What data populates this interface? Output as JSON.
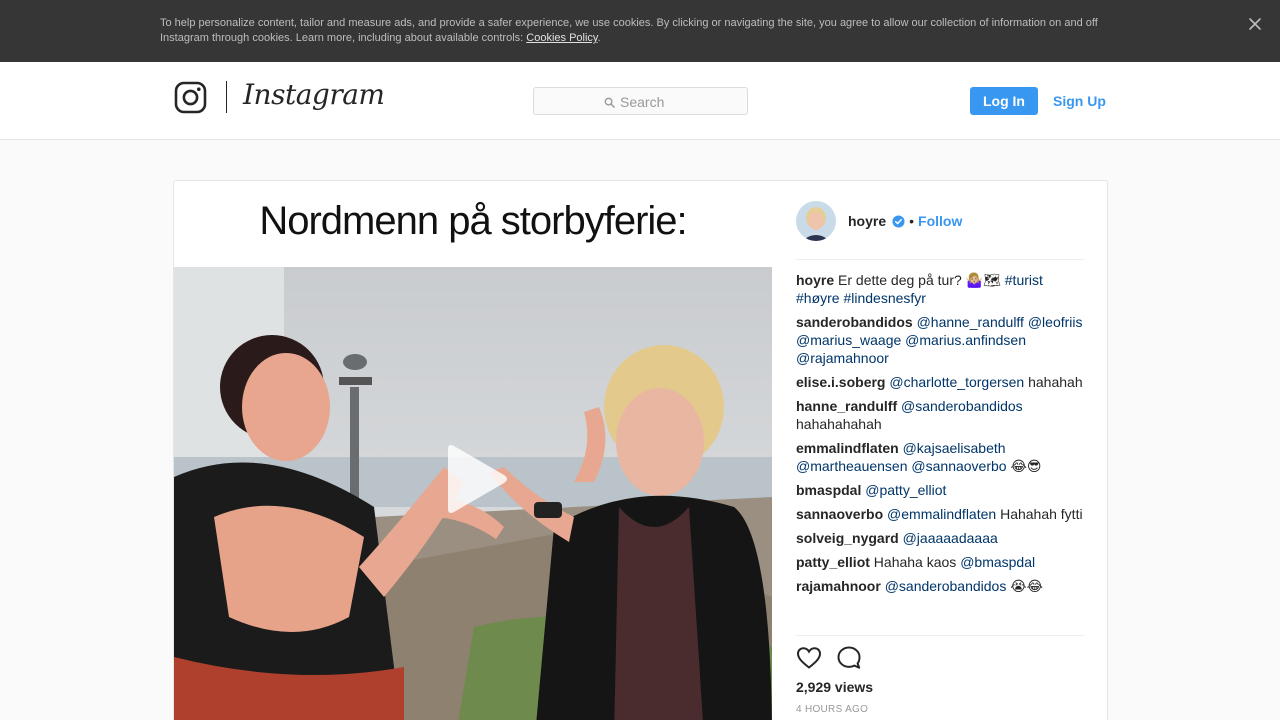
{
  "cookie_banner": {
    "text": "To help personalize content, tailor and measure ads, and provide a safer experience, we use cookies. By clicking or navigating the site, you agree to allow our collection of information on and off Instagram through cookies. Learn more, including about available controls: ",
    "link": "Cookies Policy",
    "suffix": ".",
    "close_icon": "close-icon"
  },
  "header": {
    "logo_icon": "instagram-glyph-icon",
    "wordmark": "Instagram",
    "search_placeholder": "Search",
    "login_label": "Log In",
    "signup_label": "Sign Up"
  },
  "post": {
    "media_caption": "Nordmenn på storbyferie:",
    "author": "hoyre",
    "verified": true,
    "separator": "•",
    "follow_label": "Follow",
    "caption": {
      "user": "hoyre",
      "text": "Er dette deg på tur? 🤷🏼‍♀️🗺",
      "tag1": "#turist",
      "tag2": "#høyre",
      "tag3": "#lindesnesfyr"
    },
    "comments": [
      {
        "user": "sanderobandidos",
        "m1": "@hanne_randulff",
        "m2": "@leofriis",
        "m3": "@marius_waage",
        "m4": "@marius.anfindsen",
        "m5": "@rajamahnoor"
      },
      {
        "user": "elise.i.soberg",
        "m1": "@charlotte_torgersen",
        "text": "hahahah"
      },
      {
        "user": "hanne_randulff",
        "m1": "@sanderobandidos",
        "text": "hahahahahah"
      },
      {
        "user": "emmalindflaten",
        "m1": "@kajsaelisabeth",
        "m2": "@martheauensen",
        "m3": "@sannaoverbo",
        "text": "😂😎"
      },
      {
        "user": "bmaspdal",
        "m1": "@patty_elliot"
      },
      {
        "user": "sannaoverbo",
        "m1": "@emmalindflaten",
        "text": "Hahahah fytti"
      },
      {
        "user": "solveig_nygard",
        "m1": "@jaaaaadaaaa"
      },
      {
        "user": "patty_elliot",
        "text": "Hahaha kaos",
        "m1": "@bmaspdal"
      },
      {
        "user": "rajamahnoor",
        "m1": "@sanderobandidos",
        "text": "😭😂"
      }
    ],
    "views": "2,929 views",
    "time": "4 hours ago",
    "icons": {
      "like": "heart-icon",
      "comment": "comment-icon",
      "play": "play-icon"
    }
  }
}
